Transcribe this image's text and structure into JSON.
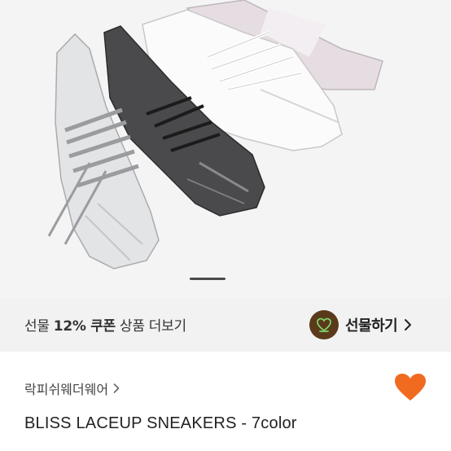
{
  "gift_bar": {
    "coupon_prefix": "선물 ",
    "coupon_highlight": "12% 쿠폰",
    "coupon_suffix": " 상품 더보기",
    "gift_button_label": "선물하기"
  },
  "product": {
    "brand": "락피쉬웨더웨어",
    "title": "BLISS LACEUP SNEAKERS - 7color"
  },
  "carousel": {
    "current": 1
  },
  "colors": {
    "heart": "#f06a1f",
    "gift_icon_bg": "#5a3a1a",
    "gift_icon_fg": "#7bd36a"
  }
}
